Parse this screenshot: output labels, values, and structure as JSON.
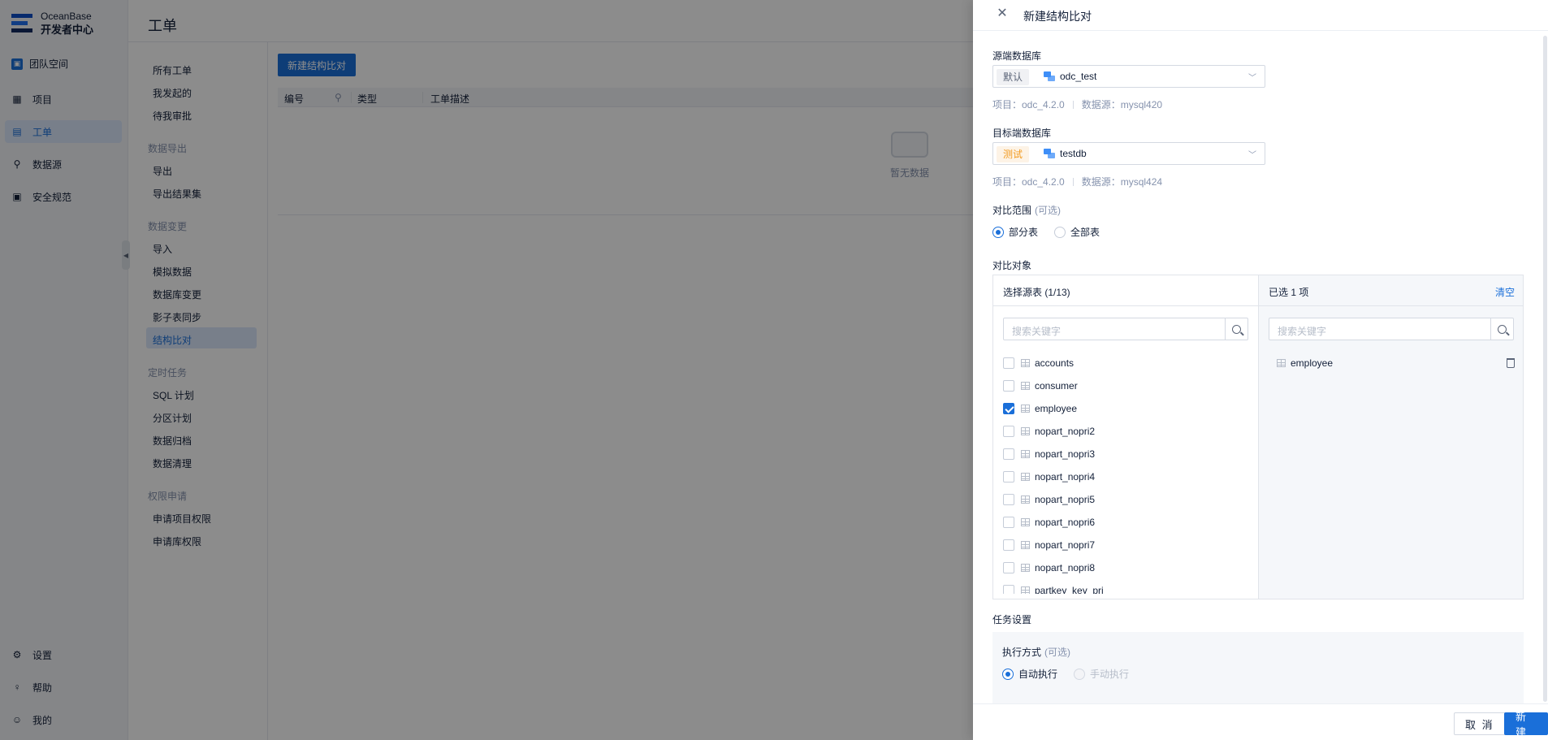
{
  "app": {
    "brand_line1": "OceanBase",
    "brand_line2": "开发者中心",
    "team_space": "团队空间",
    "nav": [
      {
        "label": "项目",
        "icon": "grid-icon"
      },
      {
        "label": "工单",
        "icon": "ticket-icon"
      },
      {
        "label": "数据源",
        "icon": "link-icon"
      },
      {
        "label": "安全规范",
        "icon": "shield-list-icon"
      }
    ],
    "nav_bottom": [
      {
        "label": "设置",
        "icon": "gear-icon"
      },
      {
        "label": "帮助",
        "icon": "bulb-icon"
      },
      {
        "label": "我的",
        "icon": "user-icon"
      }
    ],
    "page_title": "工单",
    "submenu": {
      "top": [
        "所有工单",
        "我发起的",
        "待我审批"
      ],
      "group_export": "数据导出",
      "export": [
        "导出",
        "导出结果集"
      ],
      "group_change": "数据变更",
      "change": [
        "导入",
        "模拟数据",
        "数据库变更",
        "影子表同步",
        "结构比对"
      ],
      "group_schedule": "定时任务",
      "schedule": [
        "SQL 计划",
        "分区计划",
        "数据归档",
        "数据清理"
      ],
      "group_perm": "权限申请",
      "perm": [
        "申请项目权限",
        "申请库权限"
      ]
    },
    "new_compare_button": "新建结构比对",
    "table_headers": [
      "编号",
      "类型",
      "工单描述"
    ],
    "empty_text": "暂无数据"
  },
  "drawer": {
    "title": "新建结构比对",
    "source_label": "源端数据库",
    "source": {
      "env": "默认",
      "db": "odc_test",
      "project": "项目：odc_4.2.0",
      "datasource": "数据源：mysql420"
    },
    "target_label": "目标端数据库",
    "target": {
      "env": "测试",
      "db": "testdb",
      "project": "项目：odc_4.2.0",
      "datasource": "数据源：mysql424"
    },
    "scope_label": "对比范围",
    "optional": "(可选)",
    "scope_options": [
      "部分表",
      "全部表"
    ],
    "object_label": "对比对象",
    "left_head": "选择源表 (1/13)",
    "right_head": "已选 1 项",
    "clear": "清空",
    "search_placeholder": "搜索关键字",
    "tables": [
      {
        "name": "accounts",
        "checked": false
      },
      {
        "name": "consumer",
        "checked": false
      },
      {
        "name": "employee",
        "checked": true
      },
      {
        "name": "nopart_nopri2",
        "checked": false
      },
      {
        "name": "nopart_nopri3",
        "checked": false
      },
      {
        "name": "nopart_nopri4",
        "checked": false
      },
      {
        "name": "nopart_nopri5",
        "checked": false
      },
      {
        "name": "nopart_nopri6",
        "checked": false
      },
      {
        "name": "nopart_nopri7",
        "checked": false
      },
      {
        "name": "nopart_nopri8",
        "checked": false
      },
      {
        "name": "partkey_key_pri",
        "checked": false
      }
    ],
    "selected": [
      "employee"
    ],
    "task_label": "任务设置",
    "exec_label": "执行方式",
    "exec_options": [
      "自动执行",
      "手动执行"
    ],
    "cancel": "取 消",
    "create": "新 建"
  },
  "colors": {
    "accent": "#1a6fd9",
    "test_tag": "#f29a1e"
  }
}
